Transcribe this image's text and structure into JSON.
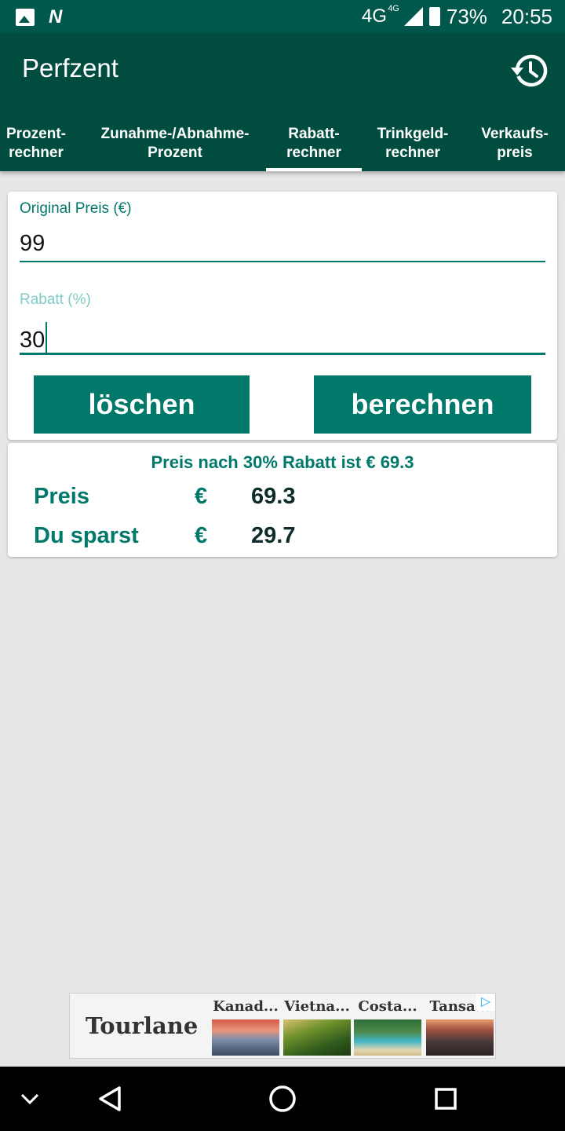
{
  "status_bar": {
    "network": "4G",
    "network_small": "4G",
    "battery": "73%",
    "time": "20:55"
  },
  "app": {
    "title": "Perfzent",
    "history_icon": "history-icon"
  },
  "tabs": [
    {
      "label": "Prozent-\nrechner",
      "selected": false
    },
    {
      "label": "Zunahme-/Abnahme-\nProzent",
      "selected": false
    },
    {
      "label": "Rabatt-\nrechner",
      "selected": true
    },
    {
      "label": "Trinkgeld-\nrechner",
      "selected": false
    },
    {
      "label": "Verkaufs-\npreis",
      "selected": false
    }
  ],
  "form": {
    "original_price_label": "Original Preis (€)",
    "original_price_value": "99",
    "discount_label": "Rabatt (%)",
    "discount_value": "30",
    "clear_button": "löschen",
    "calculate_button": "berechnen"
  },
  "result": {
    "summary": "Preis nach 30% Rabatt ist € 69.3",
    "rows": [
      {
        "label": "Preis",
        "currency": "€",
        "value": "69.3"
      },
      {
        "label": "Du sparst",
        "currency": "€",
        "value": "29.7"
      }
    ]
  },
  "ad": {
    "brand": "Tourlane",
    "items": [
      {
        "title": "Kanad..."
      },
      {
        "title": "Vietna..."
      },
      {
        "title": "Costa..."
      },
      {
        "title": "Tansa..."
      }
    ],
    "badge_icon": "adchoices-icon"
  },
  "colors": {
    "status_bar": "#00574b",
    "app_bar": "#004d40",
    "accent": "#00796b",
    "background": "#e6e6e6"
  }
}
